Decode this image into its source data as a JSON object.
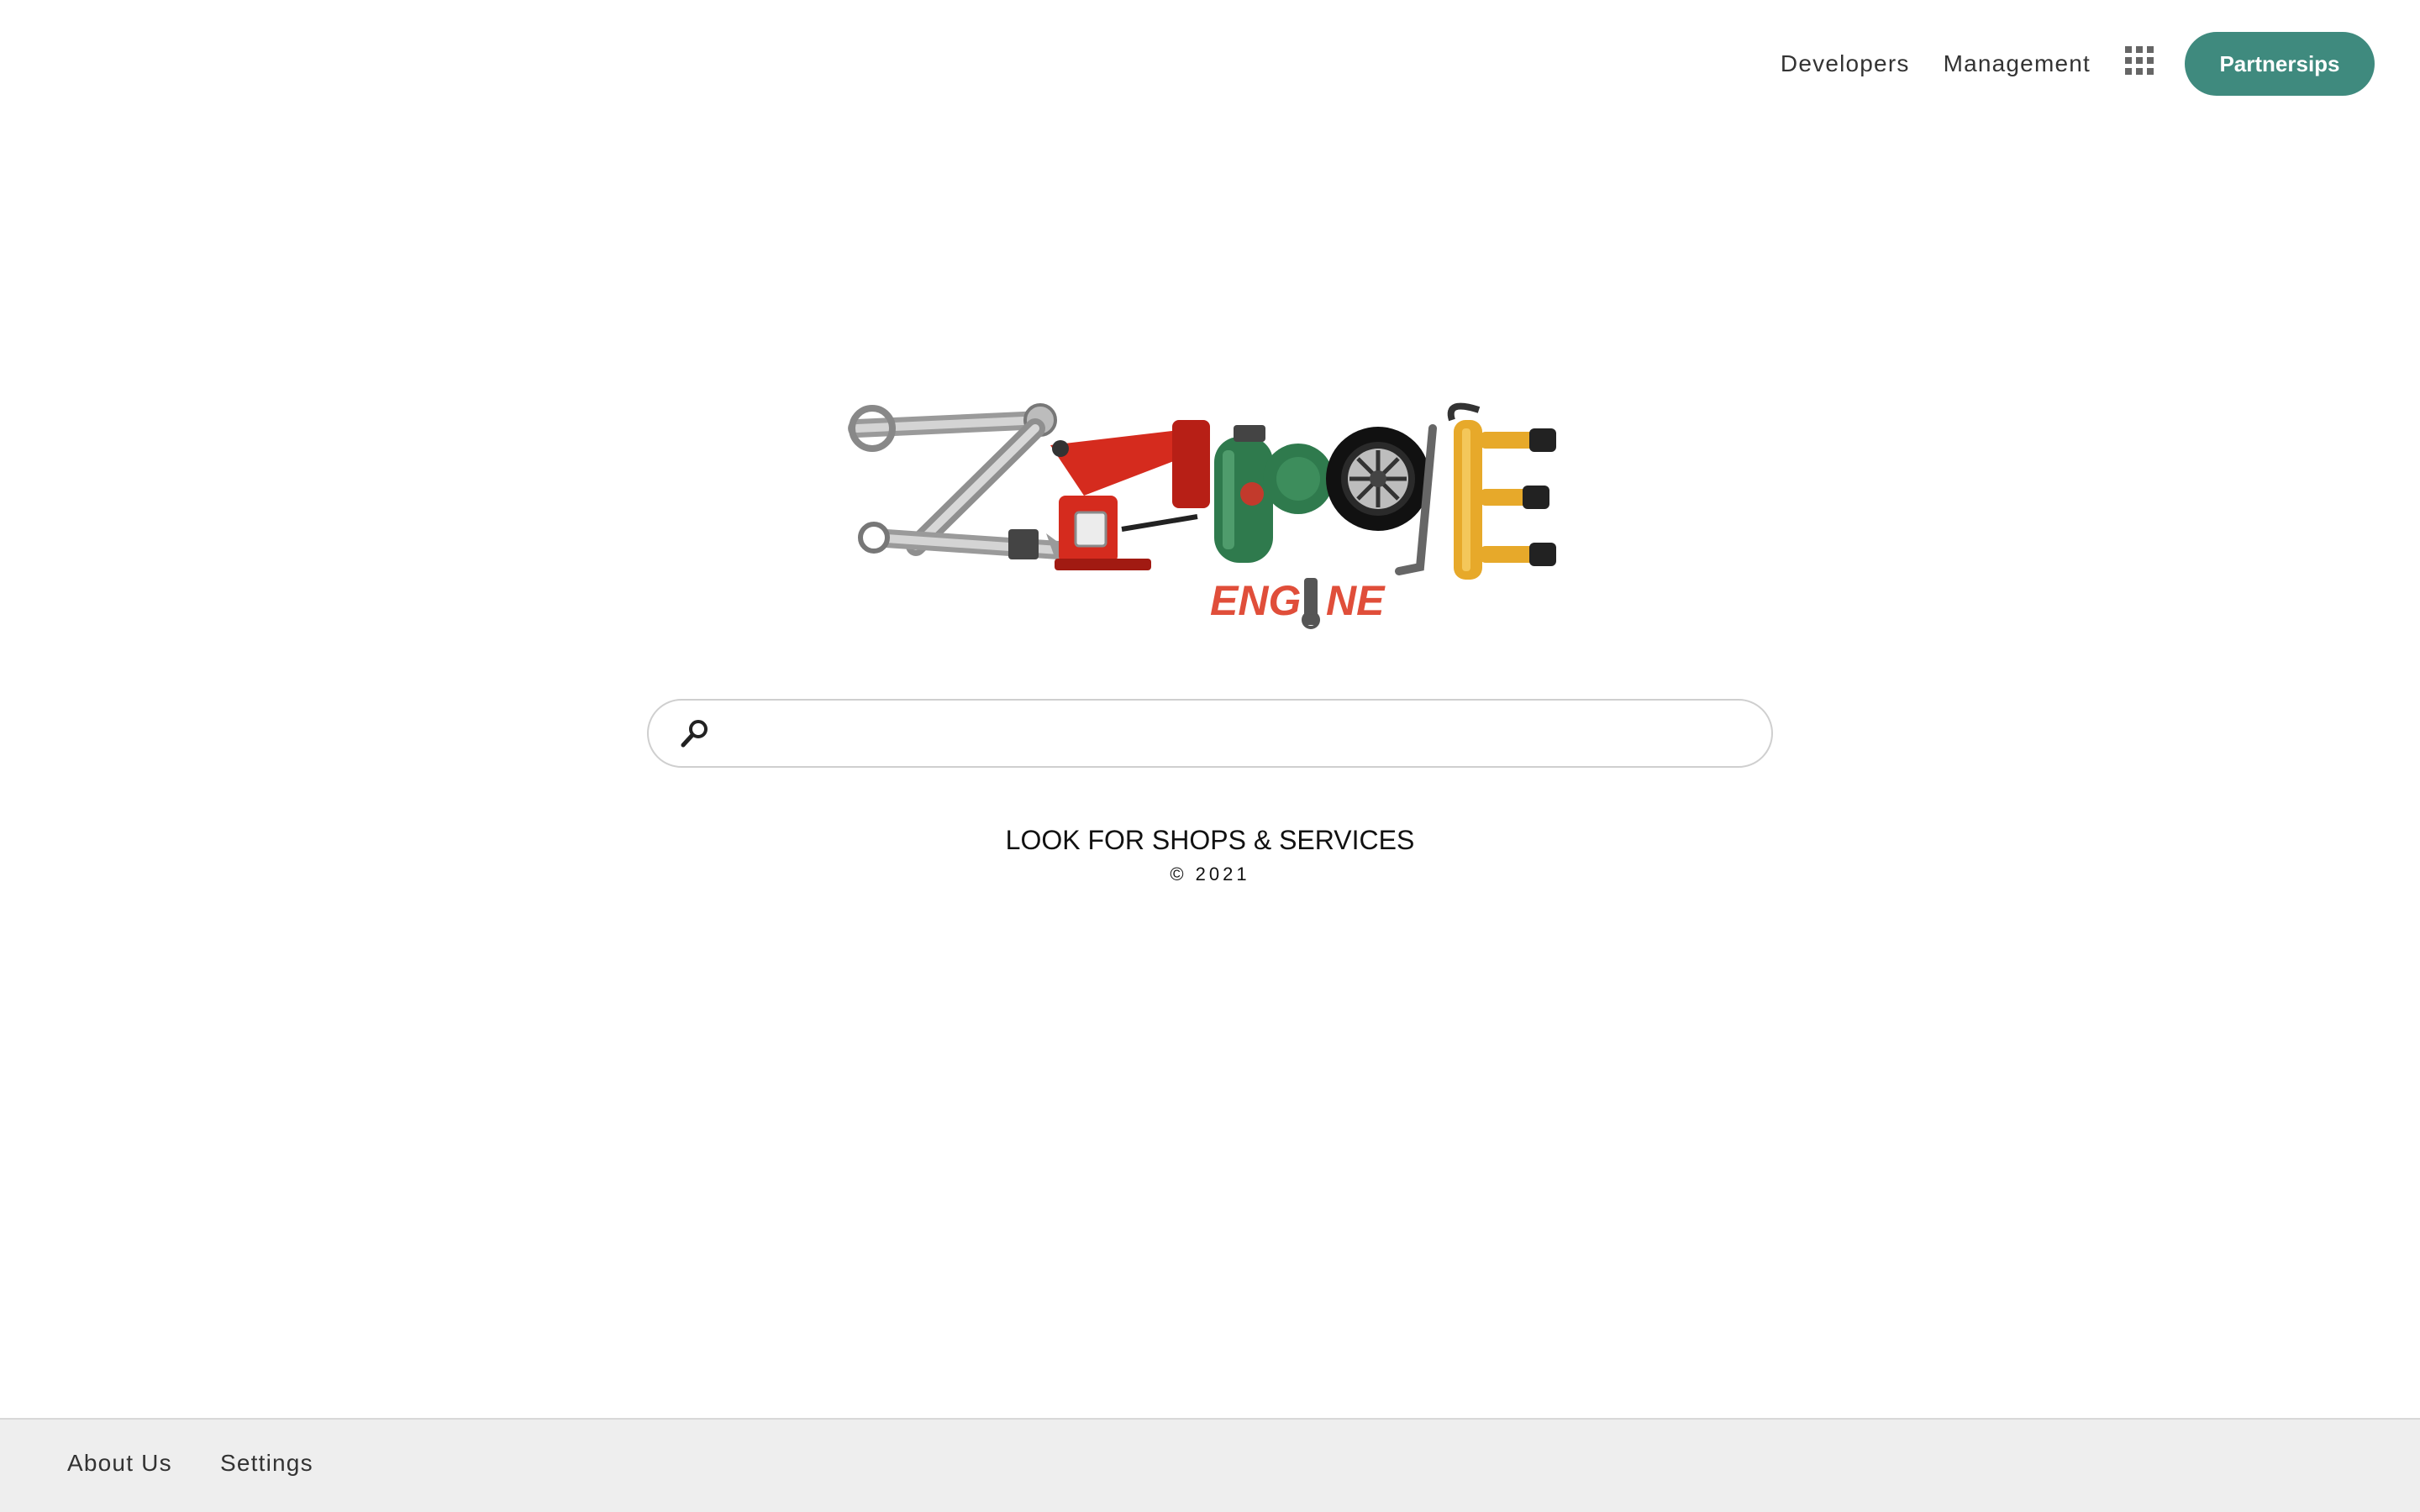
{
  "header": {
    "nav": [
      {
        "label": "Developers"
      },
      {
        "label": "Management"
      }
    ],
    "apps_icon": "apps-grid-icon",
    "cta_label": "Partnersips",
    "cta_color": "#3f8a7e"
  },
  "logo": {
    "text": "ZAPPE",
    "sub_text": "ENGINE",
    "sub_color": "#e04e3a"
  },
  "search": {
    "icon": "search-icon",
    "value": "",
    "placeholder": ""
  },
  "main": {
    "tagline": "LOOK FOR SHOPS & SERVICES",
    "copyright": "© 2021"
  },
  "footer": {
    "links": [
      {
        "label": "About Us"
      },
      {
        "label": "Settings"
      }
    ],
    "background": "#eeeeee"
  }
}
